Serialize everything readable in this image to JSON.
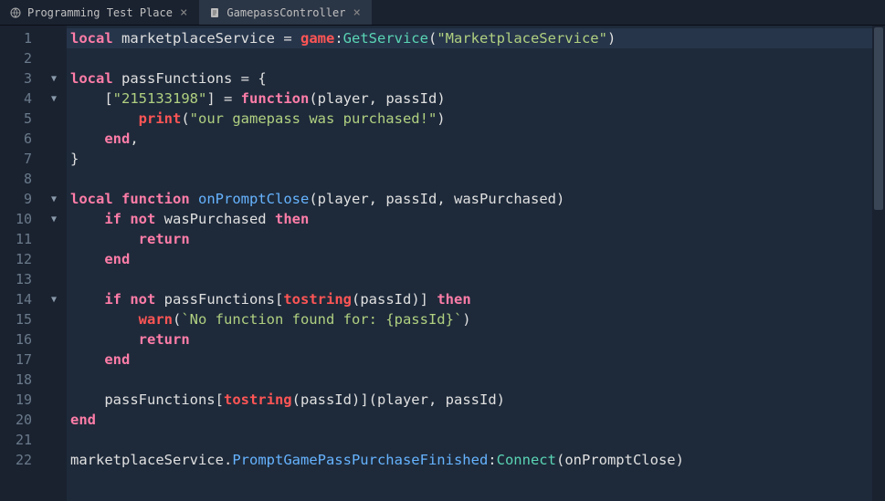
{
  "tabs": [
    {
      "label": "Programming Test Place",
      "active": false,
      "icon": "globe"
    },
    {
      "label": "GamepassController",
      "active": true,
      "icon": "script"
    }
  ],
  "foldMarkers": {
    "3": true,
    "4": true,
    "9": true,
    "10": true,
    "14": true
  },
  "lines": [
    {
      "n": 1,
      "active": true,
      "tokens": [
        {
          "t": "keyword",
          "v": "local"
        },
        {
          "t": "ident",
          "v": " marketplaceService "
        },
        {
          "t": "op",
          "v": "= "
        },
        {
          "t": "global",
          "v": "game"
        },
        {
          "t": "op",
          "v": ":"
        },
        {
          "t": "method",
          "v": "GetService"
        },
        {
          "t": "op",
          "v": "("
        },
        {
          "t": "string",
          "v": "\"MarketplaceService\""
        },
        {
          "t": "op",
          "v": ")"
        }
      ]
    },
    {
      "n": 2,
      "tokens": []
    },
    {
      "n": 3,
      "tokens": [
        {
          "t": "keyword",
          "v": "local"
        },
        {
          "t": "ident",
          "v": " passFunctions "
        },
        {
          "t": "op",
          "v": "= {"
        }
      ]
    },
    {
      "n": 4,
      "tokens": [
        {
          "t": "ident",
          "v": "    "
        },
        {
          "t": "op",
          "v": "["
        },
        {
          "t": "string",
          "v": "\"215133198\""
        },
        {
          "t": "op",
          "v": "] = "
        },
        {
          "t": "keyword",
          "v": "function"
        },
        {
          "t": "op",
          "v": "("
        },
        {
          "t": "ident",
          "v": "player"
        },
        {
          "t": "op",
          "v": ", "
        },
        {
          "t": "ident",
          "v": "passId"
        },
        {
          "t": "op",
          "v": ")"
        }
      ]
    },
    {
      "n": 5,
      "tokens": [
        {
          "t": "ident",
          "v": "        "
        },
        {
          "t": "builtin",
          "v": "print"
        },
        {
          "t": "op",
          "v": "("
        },
        {
          "t": "string",
          "v": "\"our gamepass was purchased!\""
        },
        {
          "t": "op",
          "v": ")"
        }
      ]
    },
    {
      "n": 6,
      "tokens": [
        {
          "t": "ident",
          "v": "    "
        },
        {
          "t": "keyword",
          "v": "end"
        },
        {
          "t": "op",
          "v": ","
        }
      ]
    },
    {
      "n": 7,
      "tokens": [
        {
          "t": "op",
          "v": "}"
        }
      ]
    },
    {
      "n": 8,
      "tokens": []
    },
    {
      "n": 9,
      "tokens": [
        {
          "t": "keyword",
          "v": "local function"
        },
        {
          "t": "ident",
          "v": " "
        },
        {
          "t": "func",
          "v": "onPromptClose"
        },
        {
          "t": "op",
          "v": "("
        },
        {
          "t": "ident",
          "v": "player"
        },
        {
          "t": "op",
          "v": ", "
        },
        {
          "t": "ident",
          "v": "passId"
        },
        {
          "t": "op",
          "v": ", "
        },
        {
          "t": "ident",
          "v": "wasPurchased"
        },
        {
          "t": "op",
          "v": ")"
        }
      ]
    },
    {
      "n": 10,
      "tokens": [
        {
          "t": "ident",
          "v": "    "
        },
        {
          "t": "keyword",
          "v": "if not"
        },
        {
          "t": "ident",
          "v": " wasPurchased "
        },
        {
          "t": "keyword",
          "v": "then"
        }
      ]
    },
    {
      "n": 11,
      "tokens": [
        {
          "t": "ident",
          "v": "        "
        },
        {
          "t": "keyword",
          "v": "return"
        }
      ]
    },
    {
      "n": 12,
      "tokens": [
        {
          "t": "ident",
          "v": "    "
        },
        {
          "t": "keyword",
          "v": "end"
        }
      ]
    },
    {
      "n": 13,
      "tokens": []
    },
    {
      "n": 14,
      "tokens": [
        {
          "t": "ident",
          "v": "    "
        },
        {
          "t": "keyword",
          "v": "if not"
        },
        {
          "t": "ident",
          "v": " passFunctions"
        },
        {
          "t": "op",
          "v": "["
        },
        {
          "t": "builtin",
          "v": "tostring"
        },
        {
          "t": "op",
          "v": "("
        },
        {
          "t": "ident",
          "v": "passId"
        },
        {
          "t": "op",
          "v": ")] "
        },
        {
          "t": "keyword",
          "v": "then"
        }
      ]
    },
    {
      "n": 15,
      "tokens": [
        {
          "t": "ident",
          "v": "        "
        },
        {
          "t": "builtin",
          "v": "warn"
        },
        {
          "t": "op",
          "v": "("
        },
        {
          "t": "string",
          "v": "`No function found for: {passId}`"
        },
        {
          "t": "op",
          "v": ")"
        }
      ]
    },
    {
      "n": 16,
      "tokens": [
        {
          "t": "ident",
          "v": "        "
        },
        {
          "t": "keyword",
          "v": "return"
        }
      ]
    },
    {
      "n": 17,
      "tokens": [
        {
          "t": "ident",
          "v": "    "
        },
        {
          "t": "keyword",
          "v": "end"
        }
      ]
    },
    {
      "n": 18,
      "tokens": []
    },
    {
      "n": 19,
      "tokens": [
        {
          "t": "ident",
          "v": "    passFunctions"
        },
        {
          "t": "op",
          "v": "["
        },
        {
          "t": "builtin",
          "v": "tostring"
        },
        {
          "t": "op",
          "v": "("
        },
        {
          "t": "ident",
          "v": "passId"
        },
        {
          "t": "op",
          "v": ")]("
        },
        {
          "t": "ident",
          "v": "player"
        },
        {
          "t": "op",
          "v": ", "
        },
        {
          "t": "ident",
          "v": "passId"
        },
        {
          "t": "op",
          "v": ")"
        }
      ]
    },
    {
      "n": 20,
      "tokens": [
        {
          "t": "keyword",
          "v": "end"
        }
      ]
    },
    {
      "n": 21,
      "tokens": []
    },
    {
      "n": 22,
      "tokens": [
        {
          "t": "ident",
          "v": "marketplaceService"
        },
        {
          "t": "op",
          "v": "."
        },
        {
          "t": "property",
          "v": "PromptGamePassPurchaseFinished"
        },
        {
          "t": "op",
          "v": ":"
        },
        {
          "t": "method",
          "v": "Connect"
        },
        {
          "t": "op",
          "v": "("
        },
        {
          "t": "ident",
          "v": "onPromptClose"
        },
        {
          "t": "op",
          "v": ")"
        }
      ]
    }
  ]
}
